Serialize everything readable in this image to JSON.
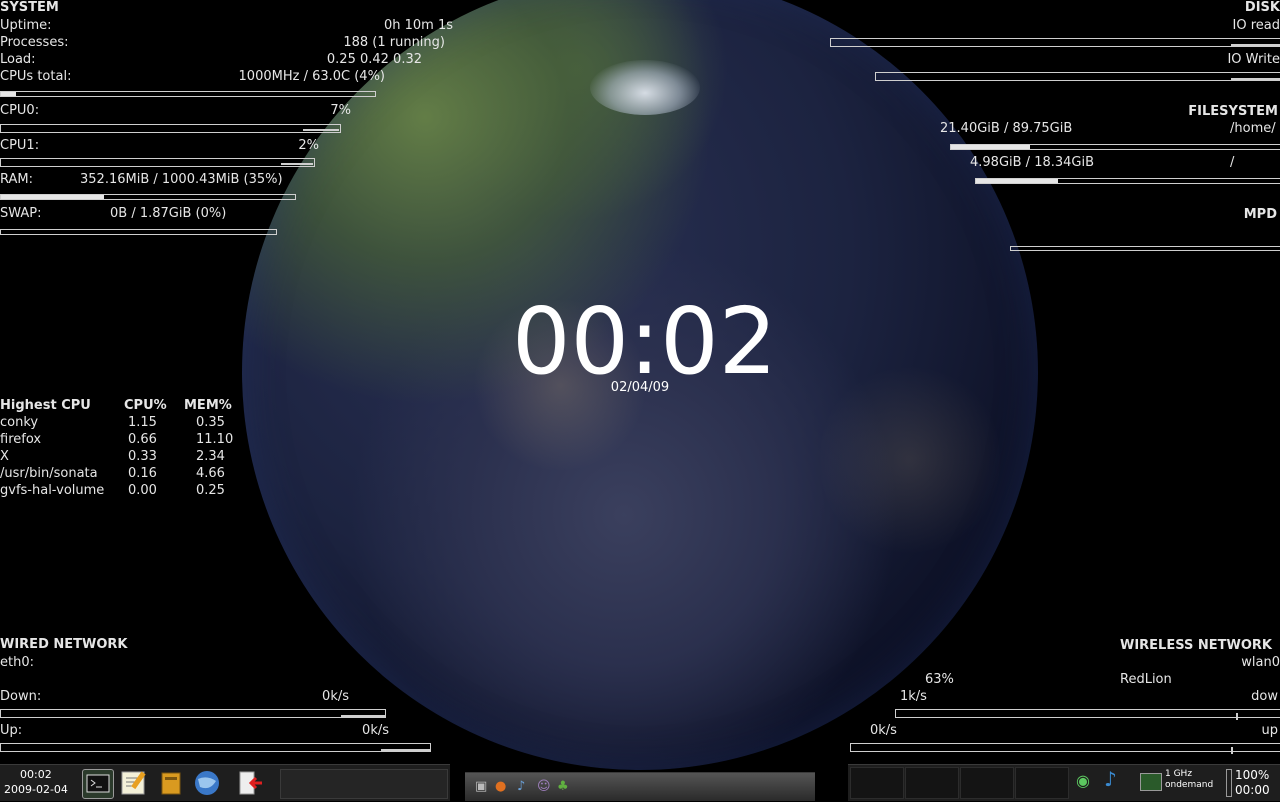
{
  "system": {
    "title": "SYSTEM",
    "uptime_label": "Uptime:",
    "uptime": "0h 10m 1s",
    "processes_label": "Processes:",
    "processes": "188 (1 running)",
    "load_label": "Load:",
    "load": "0.25 0.42 0.32",
    "cpus_label": "CPUs total:",
    "cpus": "1000MHz / 63.0C (4%)",
    "cpus_bar": 0.04,
    "cpu0_label": "CPU0:",
    "cpu0": "7%",
    "cpu0_bar": 0.07,
    "cpu1_label": "CPU1:",
    "cpu1": "2%",
    "cpu1_bar": 0.02,
    "ram_label": "RAM:",
    "ram": "352.16MiB / 1000.43MiB (35%)",
    "ram_bar": 0.35,
    "swap_label": "SWAP:",
    "swap": "0B / 1.87GiB (0%)",
    "swap_bar": 0.0
  },
  "top": {
    "title": "Highest CPU",
    "col_cpu": "CPU%",
    "col_mem": "MEM%",
    "rows": [
      {
        "name": "conky",
        "cpu": "1.15",
        "mem": "0.35"
      },
      {
        "name": "firefox",
        "cpu": "0.66",
        "mem": "11.10"
      },
      {
        "name": "X",
        "cpu": "0.33",
        "mem": "2.34"
      },
      {
        "name": "/usr/bin/sonata",
        "cpu": "0.16",
        "mem": "4.66"
      },
      {
        "name": "gvfs-hal-volume",
        "cpu": "0.00",
        "mem": "0.25"
      }
    ]
  },
  "disk": {
    "title": "DISK",
    "io_read": "IO read",
    "io_write": "IO Write"
  },
  "filesystem": {
    "title": "FILESYSTEM",
    "home_usage": "21.40GiB / 89.75GiB",
    "home_mount": "/home/",
    "home_bar": 0.24,
    "root_usage": "4.98GiB / 18.34GiB",
    "root_mount": "/",
    "root_bar": 0.27
  },
  "mpd": {
    "title": "MPD"
  },
  "clock": {
    "time": "00:02",
    "date": "02/04/09"
  },
  "wired": {
    "title": "WIRED NETWORK",
    "iface": "eth0:",
    "down_label": "Down:",
    "down": "0k/s",
    "up_label": "Up:",
    "up": "0k/s"
  },
  "wireless": {
    "title": "WIRELESS NETWORK",
    "iface": "wlan0",
    "signal": "63%",
    "essid": "RedLion",
    "down": "1k/s",
    "down_label": "dow",
    "up": "0k/s",
    "up_label": "up"
  },
  "taskbar": {
    "clock_time": "00:02",
    "clock_date": "2009-02-04",
    "cpufreq": "1 GHz",
    "governor": "ondemand",
    "battery": "100%",
    "battery_time": "00:00"
  }
}
